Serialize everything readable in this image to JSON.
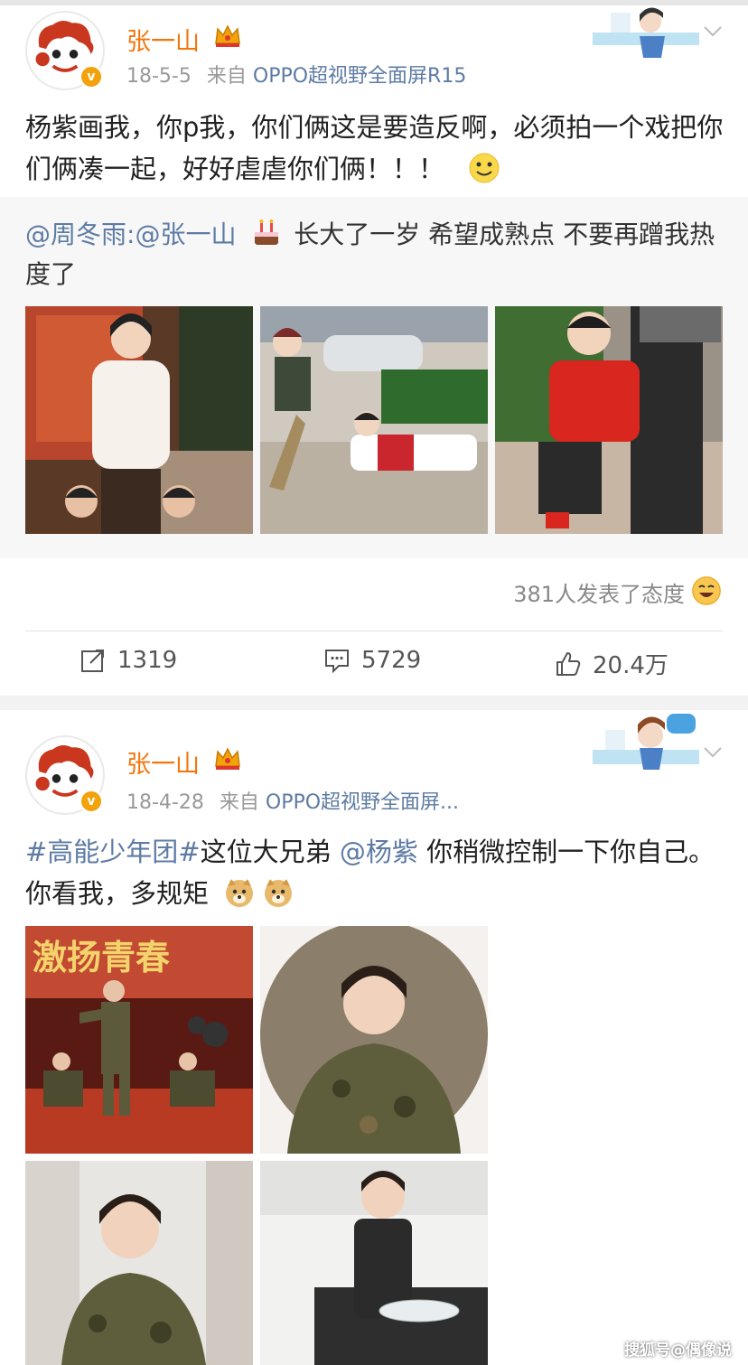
{
  "post1": {
    "author": "张一山",
    "date": "18-5-5",
    "source_prefix": "来自",
    "source": "OPPO超视野全面屏R15",
    "text": "杨紫画我，你p我，你们俩这是要造反啊，必须拍一个戏把你们俩凑一起，好好虐虐你们俩！！！",
    "repost": {
      "mention": "@周冬雨",
      "colon": ":",
      "mention2": "@张一山",
      "text": "长大了一岁 希望成熟点 不要再蹭我热度了"
    },
    "attitude_text": "381人发表了态度",
    "actions": {
      "repost_count": "1319",
      "comment_count": "5729",
      "like_count": "20.4万"
    }
  },
  "post2": {
    "author": "张一山",
    "date": "18-4-28",
    "source_prefix": "来自",
    "source": "OPPO超视野全面屏...",
    "hashtag": "#高能少年团#",
    "text_part1": "这位大兄弟",
    "mention": "@杨紫",
    "text_part2": "你稍微控制一下你自己。你看我，多规矩",
    "image1_caption": "激扬青春"
  },
  "icons": [
    "avatar-monkey-icon",
    "crown-icon",
    "chevron-down-icon",
    "repost-icon",
    "comment-icon",
    "like-icon",
    "smile-emoji-icon",
    "cake-emoji-icon",
    "doge-emoji-icon",
    "laugh-emoji-icon"
  ],
  "watermark": "搜狐号@偶像说",
  "colors": {
    "name": "#f5750a",
    "link": "#5d7ba4",
    "meta": "#999999",
    "badge": "#f2a20b"
  }
}
